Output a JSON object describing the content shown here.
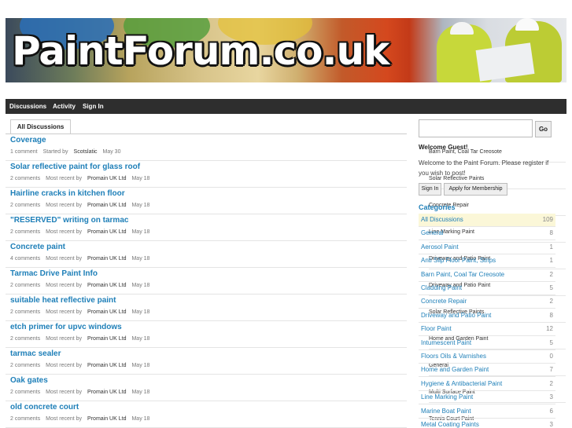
{
  "header": {
    "logo_text": "PaintForum.co.uk"
  },
  "nav": {
    "items": [
      {
        "label": "Discussions"
      },
      {
        "label": "Activity"
      },
      {
        "label": "Sign In"
      }
    ]
  },
  "tabs": {
    "active": "All Discussions"
  },
  "discussions": [
    {
      "title": "Coverage",
      "comments": "1 comment",
      "activity": "Started by",
      "user": "Scotslatic",
      "date": "May 30",
      "category": "Barn Paint, Coal Tar Creosote"
    },
    {
      "title": "Solar reflective paint for glass roof",
      "comments": "2 comments",
      "activity": "Most recent by",
      "user": "Promain UK Ltd",
      "date": "May 18",
      "category": "Solar Reflective Paints"
    },
    {
      "title": "Hairline cracks in kitchen floor",
      "comments": "2 comments",
      "activity": "Most recent by",
      "user": "Promain UK Ltd",
      "date": "May 18",
      "category": "Concrete Repair"
    },
    {
      "title": "\"RESERVED\" writing on tarmac",
      "comments": "2 comments",
      "activity": "Most recent by",
      "user": "Promain UK Ltd",
      "date": "May 18",
      "category": "Line Marking Paint"
    },
    {
      "title": "Concrete paint",
      "comments": "4 comments",
      "activity": "Most recent by",
      "user": "Promain UK Ltd",
      "date": "May 18",
      "category": "Driveway and Patio Paint"
    },
    {
      "title": "Tarmac Drive Paint Info",
      "comments": "2 comments",
      "activity": "Most recent by",
      "user": "Promain UK Ltd",
      "date": "May 18",
      "category": "Driveway and Patio Paint"
    },
    {
      "title": "suitable heat reflective paint",
      "comments": "2 comments",
      "activity": "Most recent by",
      "user": "Promain UK Ltd",
      "date": "May 18",
      "category": "Solar Reflective Paints"
    },
    {
      "title": "etch primer for upvc windows",
      "comments": "2 comments",
      "activity": "Most recent by",
      "user": "Promain UK Ltd",
      "date": "May 18",
      "category": "Home and Garden Paint"
    },
    {
      "title": "tarmac sealer",
      "comments": "2 comments",
      "activity": "Most recent by",
      "user": "Promain UK Ltd",
      "date": "May 18",
      "category": "General"
    },
    {
      "title": "Oak gates",
      "comments": "2 comments",
      "activity": "Most recent by",
      "user": "Promain UK Ltd",
      "date": "May 18",
      "category": "Multi Surface Paint"
    },
    {
      "title": "old concrete court",
      "comments": "2 comments",
      "activity": "Most recent by",
      "user": "Promain UK Ltd",
      "date": "May 18",
      "category": "Tennis Court Paint"
    }
  ],
  "sidebar": {
    "search_placeholder": "",
    "go_label": "Go",
    "welcome_title": "Welcome Guest!",
    "welcome_text": "Welcome to the Paint Forum. Please register if you wish to post!",
    "sign_in_label": "Sign In",
    "apply_label": "Apply for Membership",
    "categories_title": "Categories",
    "categories": [
      {
        "name": "All Discussions",
        "count": "109"
      },
      {
        "name": "General",
        "count": "8"
      },
      {
        "name": "Aerosol Paint",
        "count": "1"
      },
      {
        "name": "Anti Slip Floor Paint, Strips",
        "count": "1"
      },
      {
        "name": "Barn Paint, Coal Tar Creosote",
        "count": "2"
      },
      {
        "name": "Cladding Paint",
        "count": "5"
      },
      {
        "name": "Concrete Repair",
        "count": "2"
      },
      {
        "name": "Driveway and Patio Paint",
        "count": "8"
      },
      {
        "name": "Floor Paint",
        "count": "12"
      },
      {
        "name": "Intumescent Paint",
        "count": "5"
      },
      {
        "name": "Floors Oils & Varnishes",
        "count": "0"
      },
      {
        "name": "Home and Garden Paint",
        "count": "7"
      },
      {
        "name": "Hygiene & Antibacterial Paint",
        "count": "2"
      },
      {
        "name": "Line Marking Paint",
        "count": "3"
      },
      {
        "name": "Marine Boat Paint",
        "count": "6"
      },
      {
        "name": "Metal Coating Paints",
        "count": "3"
      }
    ]
  },
  "colors": {
    "link": "#1e7fb8",
    "nav_bg": "#2e2e2e",
    "active_category_bg": "#fbf7d8"
  }
}
